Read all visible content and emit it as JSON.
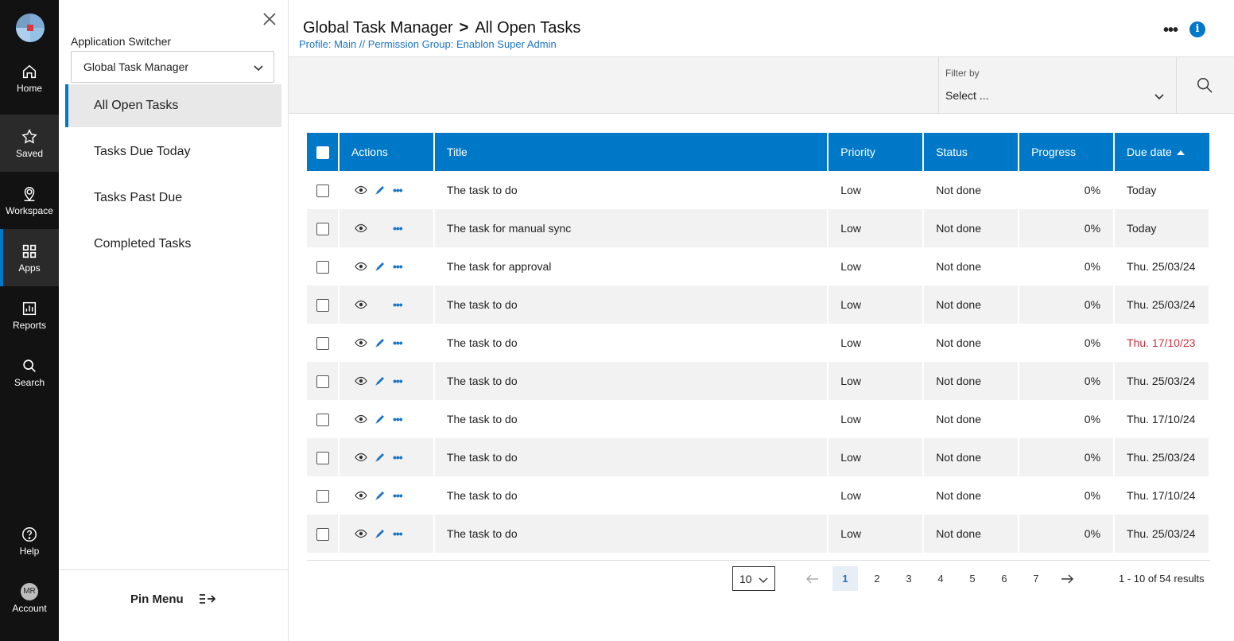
{
  "rail": {
    "items": [
      {
        "label": "Home",
        "icon": "home-icon"
      },
      {
        "label": "Saved",
        "icon": "star-icon"
      },
      {
        "label": "Workspace",
        "icon": "map-pin-icon"
      },
      {
        "label": "Apps",
        "icon": "apps-grid-icon"
      },
      {
        "label": "Reports",
        "icon": "chart-icon"
      },
      {
        "label": "Search",
        "icon": "search-icon"
      }
    ],
    "help": "Help",
    "account": "Account",
    "avatar_initials": "MR"
  },
  "panel": {
    "switcher_label": "Application Switcher",
    "switcher_value": "Global Task Manager",
    "nav": [
      "All Open Tasks",
      "Tasks Due Today",
      "Tasks Past Due",
      "Completed Tasks"
    ],
    "pin_label": "Pin Menu"
  },
  "header": {
    "app": "Global Task Manager",
    "separator": ">",
    "page": "All Open Tasks",
    "subtitle": "Profile: Main // Permission Group: Enablon Super Admin"
  },
  "filter": {
    "label": "Filter by",
    "value": "Select ..."
  },
  "table": {
    "columns": [
      "Actions",
      "Title",
      "Priority",
      "Status",
      "Progress",
      "Due date"
    ],
    "rows": [
      {
        "title": "The task to do",
        "priority": "Low",
        "status": "Not done",
        "progress": "0%",
        "due": "Today",
        "edit": true,
        "overdue": false
      },
      {
        "title": "The task for manual sync",
        "priority": "Low",
        "status": "Not done",
        "progress": "0%",
        "due": "Today",
        "edit": false,
        "overdue": false
      },
      {
        "title": "The task for approval",
        "priority": "Low",
        "status": "Not done",
        "progress": "0%",
        "due": "Thu. 25/03/24",
        "edit": true,
        "overdue": false
      },
      {
        "title": "The task to do",
        "priority": "Low",
        "status": "Not done",
        "progress": "0%",
        "due": "Thu. 25/03/24",
        "edit": false,
        "overdue": false
      },
      {
        "title": "The task to do",
        "priority": "Low",
        "status": "Not done",
        "progress": "0%",
        "due": "Thu. 17/10/23",
        "edit": true,
        "overdue": true
      },
      {
        "title": "The task to do",
        "priority": "Low",
        "status": "Not done",
        "progress": "0%",
        "due": "Thu. 25/03/24",
        "edit": true,
        "overdue": false
      },
      {
        "title": "The task to do",
        "priority": "Low",
        "status": "Not done",
        "progress": "0%",
        "due": "Thu. 17/10/24",
        "edit": true,
        "overdue": false
      },
      {
        "title": "The task to do",
        "priority": "Low",
        "status": "Not done",
        "progress": "0%",
        "due": "Thu. 25/03/24",
        "edit": true,
        "overdue": false
      },
      {
        "title": "The task to do",
        "priority": "Low",
        "status": "Not done",
        "progress": "0%",
        "due": "Thu. 17/10/24",
        "edit": true,
        "overdue": false
      },
      {
        "title": "The task to do",
        "priority": "Low",
        "status": "Not done",
        "progress": "0%",
        "due": "Thu. 25/03/24",
        "edit": true,
        "overdue": false
      }
    ]
  },
  "pagination": {
    "page_size": "10",
    "pages": [
      "1",
      "2",
      "3",
      "4",
      "5",
      "6",
      "7"
    ],
    "current": "1",
    "results": "1 - 10 of 54 results"
  },
  "colors": {
    "accent": "#0078c8",
    "overdue": "#c8303d",
    "rail": "#121212"
  }
}
